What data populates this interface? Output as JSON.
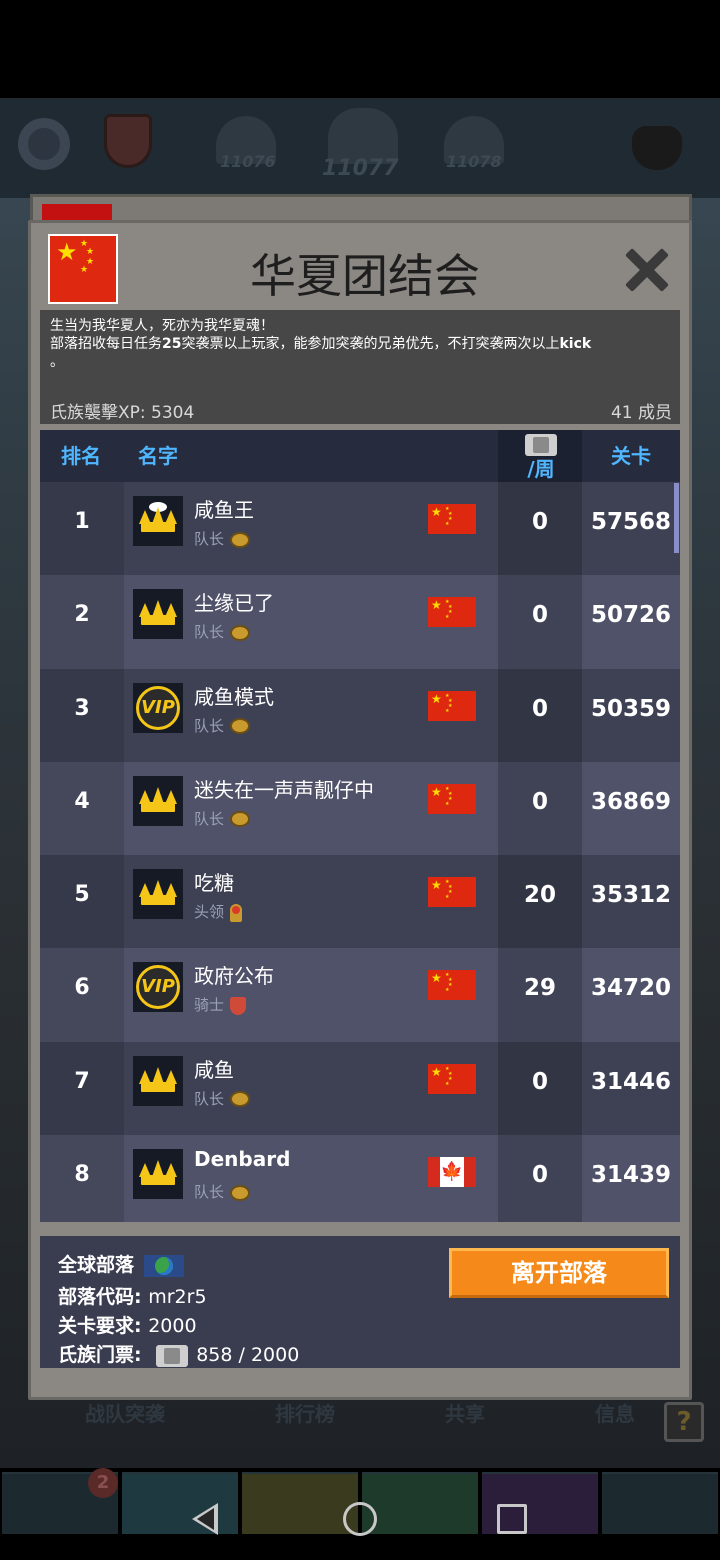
{
  "background": {
    "level_prev": "11076",
    "level_current": "11077",
    "level_next": "11078",
    "tabs": [
      "战队突袭",
      "排行榜",
      "共享",
      "信息"
    ],
    "notification_count": "2",
    "help_label": "?"
  },
  "clan": {
    "title": "华夏团结会",
    "flag": "china",
    "description_line1": "生当为我华夏人，死亦为我华夏魂！",
    "description_line2_pre": "部落招收每日任务",
    "description_line2_num": "25",
    "description_line2_mid": "突袭票以上玩家，能参加突袭的兄弟优先，不打突袭两次以上",
    "description_line2_kick": "kick",
    "description_line3": "。",
    "xp_label": "氏族襲擊XP: 5304",
    "members_label": "41 成员"
  },
  "table": {
    "headers": {
      "rank": "排名",
      "name": "名字",
      "tickets_per_week": "/周",
      "level": "关卡"
    },
    "rows": [
      {
        "rank": "1",
        "name": "咸鱼王",
        "role": "队长",
        "badge": "crown-white-icon",
        "flag": "china",
        "tickets": "0",
        "level": "57568"
      },
      {
        "rank": "2",
        "name": "尘缘已了",
        "role": "队长",
        "badge": "crown-icon",
        "flag": "china",
        "tickets": "0",
        "level": "50726"
      },
      {
        "rank": "3",
        "name": "咸鱼模式",
        "role": "队长",
        "badge": "vip-icon",
        "flag": "china",
        "tickets": "0",
        "level": "50359"
      },
      {
        "rank": "4",
        "name": "迷失在一声声靓仔中",
        "role": "队长",
        "badge": "crown-icon",
        "flag": "china",
        "tickets": "0",
        "level": "36869"
      },
      {
        "rank": "5",
        "name": "吃糖",
        "role": "头领",
        "badge": "crown-icon",
        "flag": "china",
        "tickets": "20",
        "level": "35312"
      },
      {
        "rank": "6",
        "name": "政府公布",
        "role": "骑士",
        "badge": "vip-icon",
        "flag": "china",
        "tickets": "29",
        "level": "34720"
      },
      {
        "rank": "7",
        "name": "咸鱼",
        "role": "队长",
        "badge": "crown-icon",
        "flag": "china",
        "tickets": "0",
        "level": "31446"
      },
      {
        "rank": "8",
        "name": "Denbard",
        "role": "队长",
        "badge": "crown-icon",
        "flag": "canada",
        "tickets": "0",
        "level": "31439"
      }
    ]
  },
  "footer": {
    "global_clan_label": "全球部落",
    "clan_code_label": "部落代码: ",
    "clan_code_value": "mr2r5",
    "level_req_label": "关卡要求: ",
    "level_req_value": "2000",
    "tickets_label": "氏族门票: ",
    "tickets_value": "858 / 2000",
    "leave_button": "离开部落"
  },
  "colors": {
    "header_blue": "#4fb6ff",
    "leave_orange": "#f58a1a",
    "flag_red": "#de2910",
    "flag_yellow": "#ffde00"
  }
}
